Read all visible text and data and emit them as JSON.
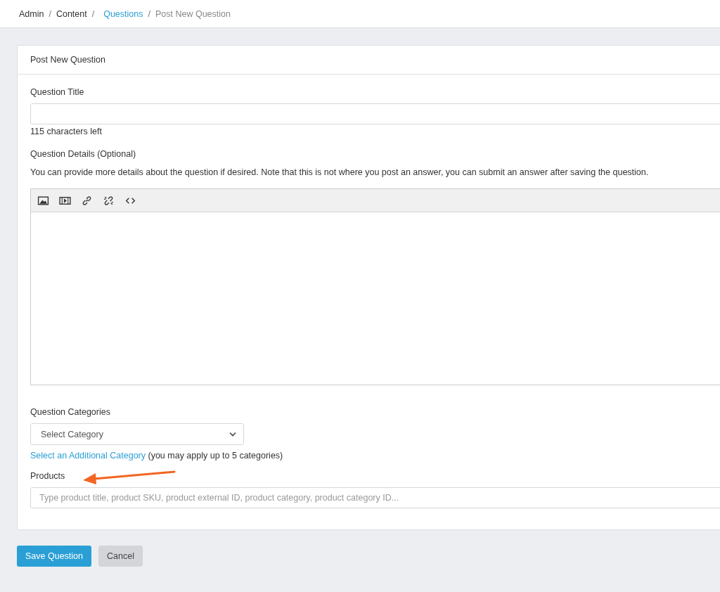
{
  "breadcrumb": {
    "separator": "/",
    "items": [
      {
        "label": "Admin",
        "kind": "plain"
      },
      {
        "label": "Content",
        "kind": "plain"
      },
      {
        "label": "Questions",
        "kind": "link"
      },
      {
        "label": "Post New Question",
        "kind": "current"
      }
    ]
  },
  "card": {
    "title": "Post New Question"
  },
  "title_field": {
    "label": "Question Title",
    "counter": "115 characters left"
  },
  "details": {
    "label": "Question Details (Optional)",
    "help": "You can provide more details about the question if desired. Note that this is not where you post an answer, you can submit an answer after saving the question.",
    "toolbar": [
      {
        "kind": "image"
      },
      {
        "kind": "video"
      },
      {
        "kind": "link"
      },
      {
        "kind": "unlink"
      },
      {
        "kind": "code"
      }
    ]
  },
  "categories": {
    "label": "Question Categories",
    "select": "Select Category",
    "add_link": "Select an Additional Category",
    "add_note": "(you may apply up to 5 categories)"
  },
  "products": {
    "label": "Products",
    "placeholder": "Type product title, product SKU, product external ID, product category, product category ID..."
  },
  "annotation": {
    "kind": "arrow",
    "color": "#f26522"
  },
  "buttons": [
    {
      "label": "Save Question",
      "kind": "primary"
    },
    {
      "label": "Cancel",
      "kind": "secondary"
    }
  ]
}
